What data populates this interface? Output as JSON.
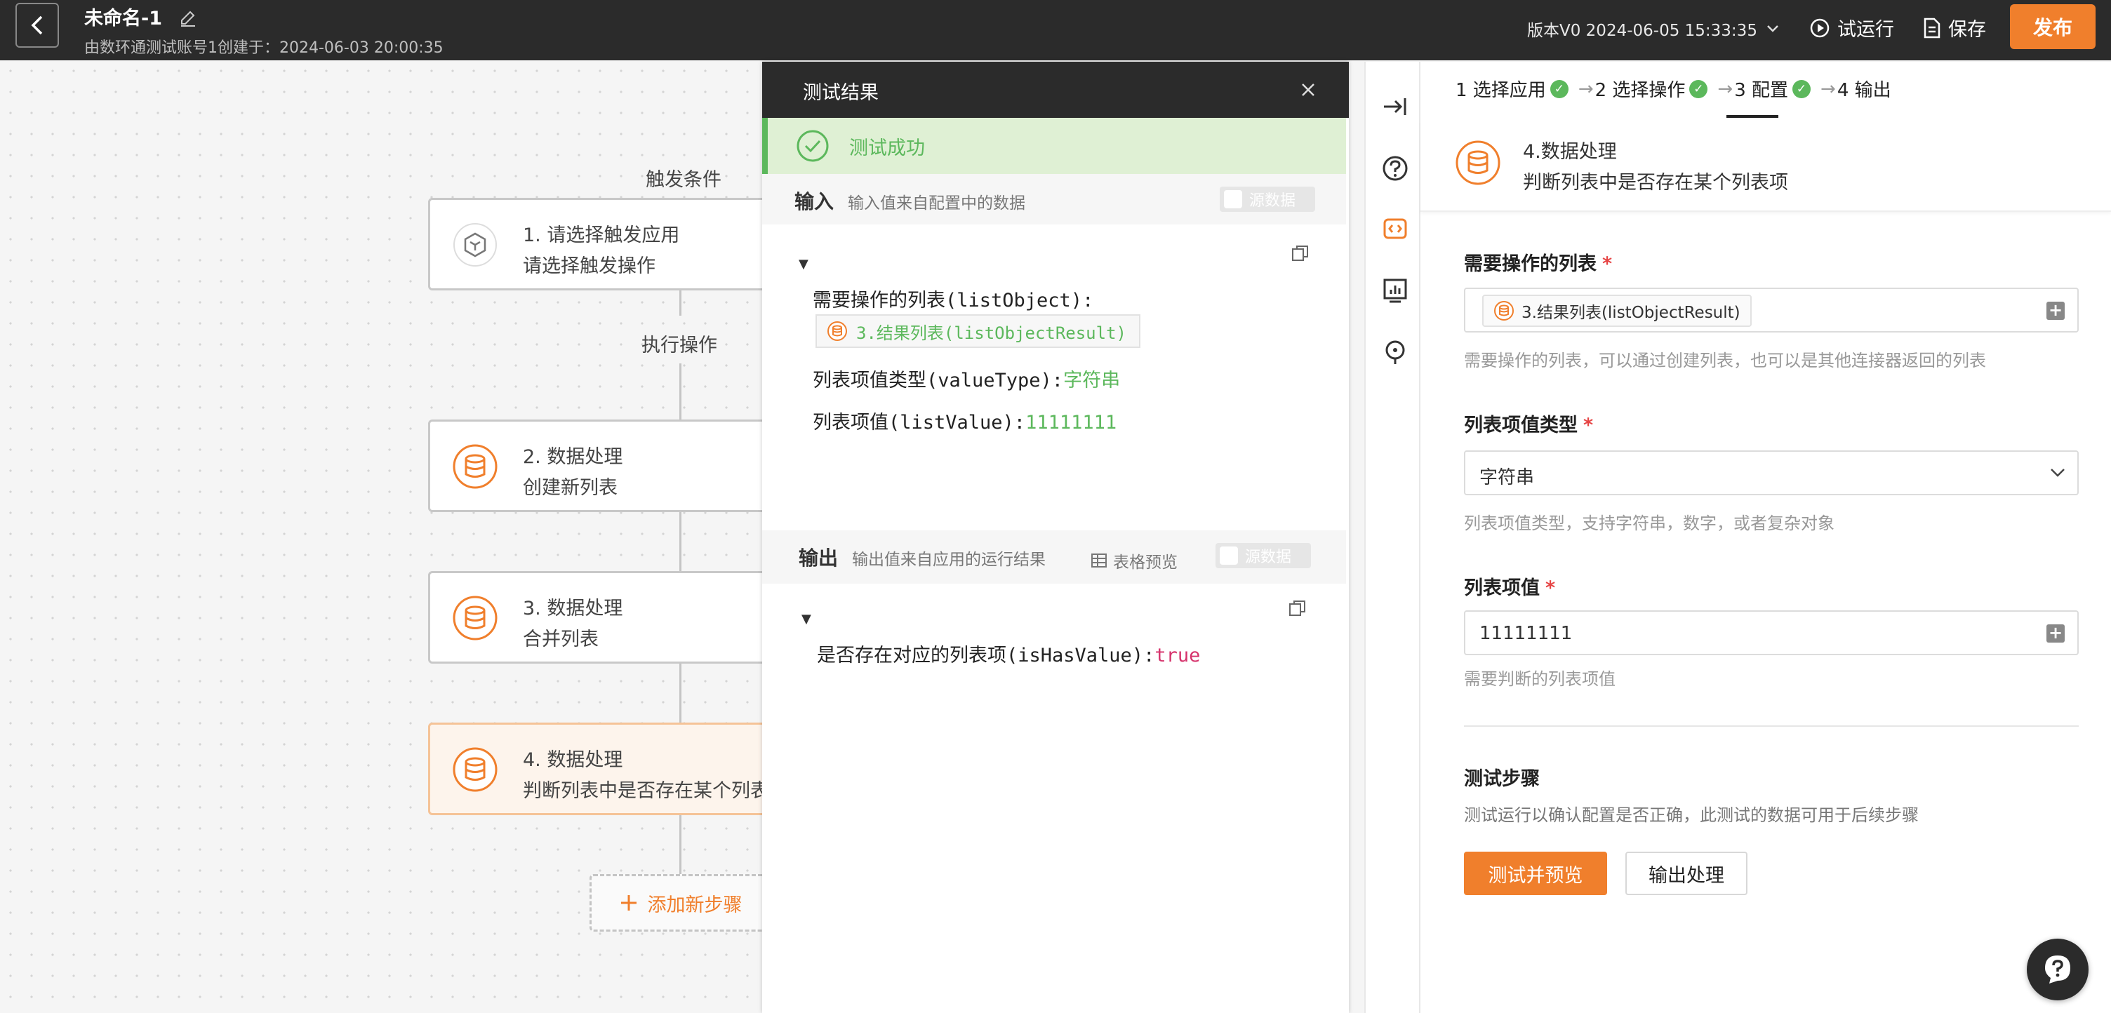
{
  "header": {
    "title": "未命名-1",
    "subtitle": "由数环通测试账号1创建于：2024-06-03 20:00:35",
    "version": "版本V0 2024-06-05 15:33:35",
    "trial_run": "试运行",
    "save": "保存",
    "publish": "发布"
  },
  "canvas": {
    "trigger_label": "触发条件",
    "action_label": "执行操作",
    "nodes": [
      {
        "title": "1. 请选择触发应用",
        "sub": "请选择触发操作"
      },
      {
        "title": "2. 数据处理",
        "sub": "创建新列表"
      },
      {
        "title": "3. 数据处理",
        "sub": "合并列表"
      },
      {
        "title": "4. 数据处理",
        "sub": "判断列表中是否存在某个列表项"
      }
    ],
    "add_step": "添加新步骤"
  },
  "result": {
    "title": "测试结果",
    "success": "测试成功",
    "input_title": "输入",
    "input_desc": "输入值来自配置中的数据",
    "raw_data": "源数据",
    "input_lines": {
      "list_key": "需要操作的列表(listObject):",
      "list_ref": "3.结果列表(listObjectResult)",
      "type_key": "列表项值类型(valueType):",
      "type_val": "字符串",
      "value_key": "列表项值(listValue):",
      "value_val": "11111111"
    },
    "output_title": "输出",
    "output_desc": "输出值来自应用的运行结果",
    "table_preview": "表格预览",
    "output_lines": {
      "key": "是否存在对应的列表项(isHasValue):",
      "val": "true"
    }
  },
  "config": {
    "steps": [
      "1 选择应用",
      "2 选择操作",
      "3 配置",
      "4 输出"
    ],
    "head_title": "4.数据处理",
    "head_sub": "判断列表中是否存在某个列表项",
    "fields": {
      "list_label": "需要操作的列表",
      "list_chip": "3.结果列表(listObjectResult)",
      "list_help": "需要操作的列表，可以通过创建列表，也可以是其他连接器返回的列表",
      "type_label": "列表项值类型",
      "type_value": "字符串",
      "type_help": "列表项值类型，支持字符串，数字，或者复杂对象",
      "value_label": "列表项值",
      "value_value": "11111111",
      "value_help": "需要判断的列表项值"
    },
    "test_title": "测试步骤",
    "test_desc": "测试运行以确认配置是否正确，此测试的数据可用于后续步骤",
    "test_button": "测试并预览",
    "output_button": "输出处理",
    "required_mark": "*"
  },
  "colors": {
    "accent": "#f07f2c",
    "success": "#5cb85c",
    "dark": "#2b2b2b"
  }
}
